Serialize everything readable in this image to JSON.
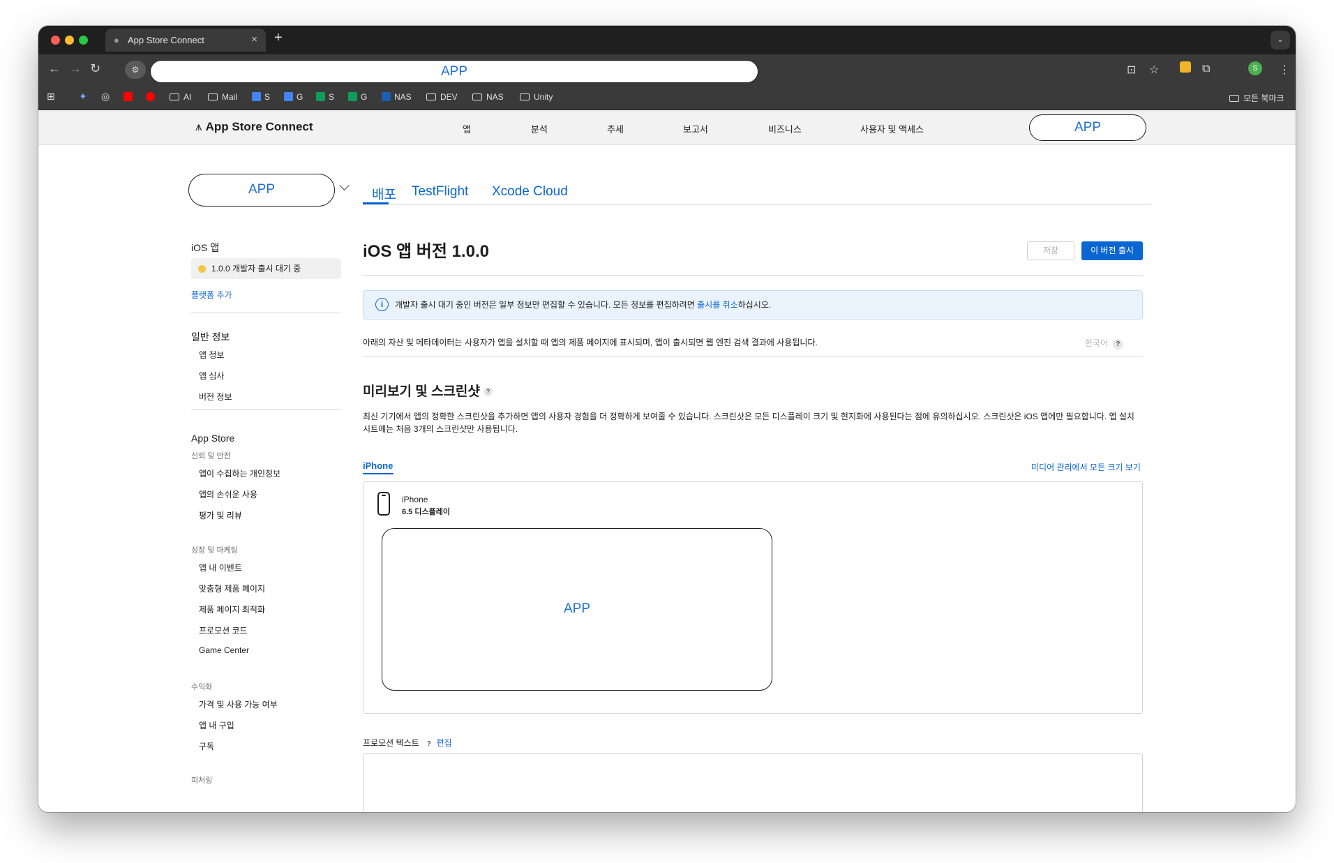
{
  "browser": {
    "tab_title": "App Store Connect",
    "new_tab": "+",
    "address_value": "APP",
    "bookmarks": [
      {
        "label": "AI",
        "type": "folder"
      },
      {
        "label": "Mail",
        "type": "folder"
      },
      {
        "label": "S",
        "type": "docs"
      },
      {
        "label": "G",
        "type": "docs"
      },
      {
        "label": "S",
        "type": "sheets"
      },
      {
        "label": "G",
        "type": "sheets"
      },
      {
        "label": "NAS",
        "type": "dsm"
      },
      {
        "label": "DEV",
        "type": "folder"
      },
      {
        "label": "NAS",
        "type": "folder"
      },
      {
        "label": "Unity",
        "type": "folder"
      }
    ],
    "all_bookmarks": "모든 북마크",
    "profile_initial": "S",
    "colors": {
      "close": "#ff5f57",
      "minimize": "#febc2e",
      "zoom": "#28c840"
    }
  },
  "header": {
    "brand": "App Store Connect",
    "nav": [
      "앱",
      "분석",
      "추세",
      "보고서",
      "비즈니스",
      "사용자 및 액세스"
    ],
    "app_button": "APP"
  },
  "app_switcher": {
    "label": "APP"
  },
  "tabs": [
    "배포",
    "TestFlight",
    "Xcode Cloud"
  ],
  "sidebar": {
    "platform_heading": "iOS 앱",
    "status": "1.0.0 개발자 출시 대기 중",
    "add_platform": "플랫폼 추가",
    "general_heading": "일반 정보",
    "general_items": [
      "앱 정보",
      "앱 심사",
      "버전 정보"
    ],
    "appstore_heading": "App Store",
    "trust_heading": "신뢰 및 안전",
    "trust_items": [
      "앱이 수집하는 개인정보",
      "앱의 손쉬운 사용",
      "평가 및 리뷰"
    ],
    "growth_heading": "성장 및 마케팅",
    "growth_items": [
      "앱 내 이벤트",
      "맞춤형 제품 페이지",
      "제품 페이지 최적화",
      "프로모션 코드",
      "Game Center"
    ],
    "monetization_heading": "수익화",
    "monetization_items": [
      "가격 및 사용 가능 여부",
      "앱 내 구입",
      "구독"
    ],
    "featuring_heading": "피처링"
  },
  "main": {
    "title": "iOS 앱 버전 1.0.0",
    "save_button": "저장",
    "release_button": "이 버전 출시",
    "info_before": "개발자 출시 대기 중인 버전은 일부 정보만 편집할 수 있습니다. 모든 정보를 편집하려면 ",
    "info_link": "출시를 취소",
    "info_after": "하십시오.",
    "description": "아래의 자산 및 메타데이터는 사용자가 앱을 설치할 때 앱의 제품 페이지에 표시되며, 앱이 출시되면 웹 엔진 검색 결과에 사용됩니다.",
    "language": "한국어",
    "help": "?",
    "section_title": "미리보기 및 스크린샷",
    "section_desc": "최신 기기에서 앱의 정확한 스크린샷을 추가하면 앱의 사용자 경험을 더 정확하게 보여줄 수 있습니다. 스크린샷은 모든 디스플레이 크기 및 현지화에 사용된다는 점에 유의하십시오. 스크린샷은 iOS 앱에만 필요합니다. 앱 설치 시트에는 처음 3개의 스크린샷만 사용됩니다.",
    "device_tab": "iPhone",
    "media_link": "미디어 관리에서 모든 크기 보기",
    "device_name": "iPhone",
    "device_size": "6.5 디스플레이",
    "screenshot_placeholder": "APP",
    "promo_label": "프로모션 텍스트",
    "promo_edit": "편집"
  }
}
